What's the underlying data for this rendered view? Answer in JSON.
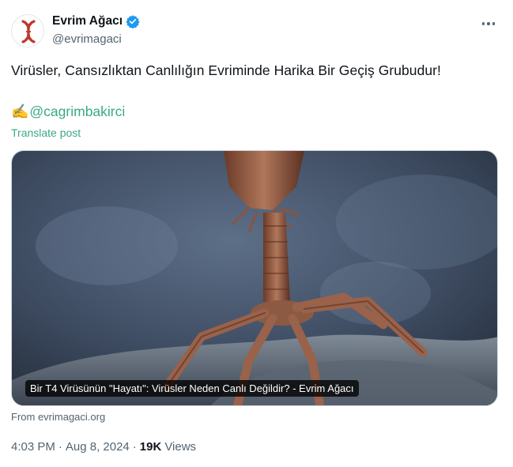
{
  "account": {
    "display_name": "Evrim Ağacı",
    "handle": "@evrimagaci",
    "verified": true,
    "accent_color": "#c0392b"
  },
  "tweet": {
    "text": "Virüsler, Cansızlıktan Canlılığın Evriminde Harika Bir Geçiş Grubudur!",
    "pen_emoji": "✍️",
    "mention": "@cagrimbakirci",
    "translate_label": "Translate post"
  },
  "media": {
    "caption": "Bir T4 Virüsünün \"Hayatı\": Virüsler Neden Canlı Değildir? - Evrim Ağacı",
    "source": "From evrimagaci.org"
  },
  "meta": {
    "time": "4:03 PM",
    "date": "Aug 8, 2024",
    "separator": "·",
    "views_count": "19K",
    "views_label": "Views"
  },
  "colors": {
    "link": "#3aa88a",
    "verified_badge": "#1d9bf0",
    "secondary_text": "#536471"
  }
}
